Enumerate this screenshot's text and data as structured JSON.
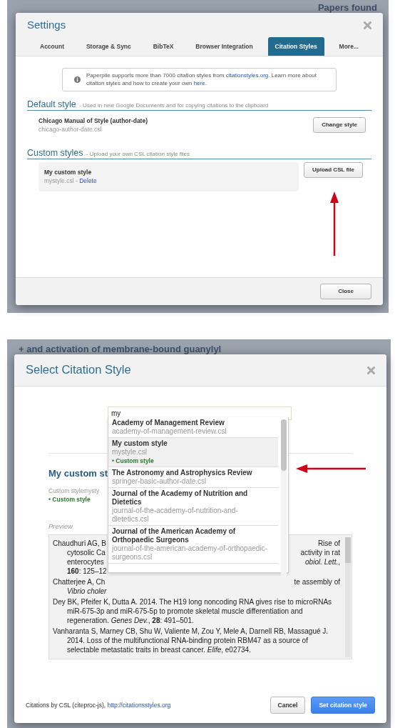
{
  "top_backdrop": {
    "text": "Papers found"
  },
  "settings_dialog": {
    "title": "Settings",
    "tabs": [
      {
        "label": "Account",
        "selected": false
      },
      {
        "label": "Storage & Sync",
        "selected": false
      },
      {
        "label": "BibTeX",
        "selected": false
      },
      {
        "label": "Browser Integration",
        "selected": false
      },
      {
        "label": "Citation Styles",
        "selected": true
      },
      {
        "label": "More...",
        "selected": false
      }
    ],
    "info": [
      {
        "kind": "text",
        "text": "Paperpile supports more than 7000 citation styles from "
      },
      {
        "kind": "link",
        "text": "citationstyles.org"
      },
      {
        "kind": "text",
        "text": ". Learn more about citation styles and how to create your own "
      },
      {
        "kind": "link",
        "text": "here"
      },
      {
        "kind": "text",
        "text": "."
      }
    ],
    "default_style": {
      "heading": "Default style",
      "description": "- Used in new Google Documents and for copying citations to the clipboard",
      "name": "Chicago Manual of Style (author-date)",
      "file": "chicago-author-date.csl",
      "button": "Change style"
    },
    "custom_styles": {
      "heading": "Custom styles",
      "description": "- Upload your own CSL citation style files",
      "items": [
        {
          "name": "My custom style",
          "file": "mystyle.csl",
          "separator": "-",
          "action": "Delete"
        }
      ],
      "button": "Upload CSL file"
    },
    "footer_button": "Close"
  },
  "bottom_backdrop": {
    "text": "+ and activation of membrane-bound guanylyl"
  },
  "select_dialog": {
    "title": "Select Citation Style",
    "search": {
      "value": "my"
    },
    "results": [
      {
        "name": "Academy of Management Review",
        "file": "academy-of-management-review.csl",
        "selected": false
      },
      {
        "name": "My custom style",
        "file": "mystyle.csl",
        "tag": "• Custom style",
        "selected": true
      },
      {
        "name": "The Astronomy and Astrophysics Review",
        "file": "springer-basic-author-date.csl",
        "selected": false
      },
      {
        "name": "Journal of the Academy of Nutrition and Dietetics",
        "file": "journal-of-the-academy-of-nutrition-and-dietetics.csl",
        "selected": false
      },
      {
        "name": "Journal of the American Academy of Orthopaedic Surgeons",
        "file": "journal-of-the-american-academy-of-orthopaedic-surgeons.csl",
        "selected": false
      }
    ],
    "detail": {
      "title": "My custom st",
      "subtitle": "Custom stylemysty",
      "tag": "• Custom style"
    },
    "preview_label": "Preview",
    "preview_entries": [
      {
        "kind": "split",
        "lines": [
          {
            "left": "Chaudhuri AG, B",
            "right": "Rise of"
          },
          {
            "left": "cytosolic Ca",
            "right": "activity in rat"
          },
          {
            "left": "enterocytes",
            "right": "*obiol. Lett.*,"
          },
          {
            "left": "**160**: 125–12"
          }
        ]
      },
      {
        "kind": "split",
        "lines": [
          {
            "left": "Chatterjee A, Ch",
            "right": "te assembly of"
          },
          {
            "left": "*Vibrio choler*"
          }
        ]
      },
      {
        "kind": "full",
        "text": "Dey BK, Pfeifer K, Dutta A. 2014. The H19 long noncoding RNA gives rise to microRNAs miR-675-3p and miR-675-5p to promote skeletal muscle differentiation and regeneration. *Genes Dev.*, **28**: 491–501."
      },
      {
        "kind": "full",
        "text": "Vanharanta S, Marney CB, Shu W, Valiente M, Zou Y, Mele A, Darnell RB, Massagué J. 2014. Loss of the multifunctional RNA-binding protein RBM47 as a source of selectable metastatic traits in breast cancer. *Elife*, e02734."
      }
    ],
    "footer_text": "Citations by CSL (citeproc-js), ",
    "footer_link": "http://citationsstyles.org",
    "buttons": [
      {
        "label": "Cancel",
        "primary": false
      },
      {
        "label": "Set citation style",
        "primary": true
      }
    ]
  }
}
